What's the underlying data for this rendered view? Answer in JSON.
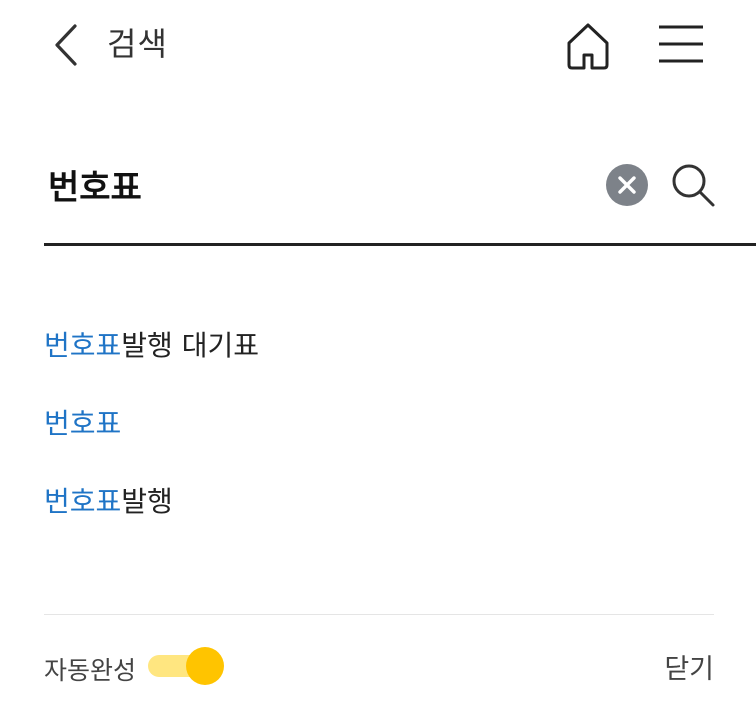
{
  "header": {
    "title": "검색"
  },
  "search": {
    "value": "번호표"
  },
  "suggestions": [
    {
      "highlight": "번호표",
      "rest": "발행 대기표"
    },
    {
      "highlight": "번호표",
      "rest": ""
    },
    {
      "highlight": "번호표",
      "rest": "발행"
    }
  ],
  "footer": {
    "autocomplete_label": "자동완성",
    "autocomplete_on": true,
    "close_label": "닫기"
  },
  "colors": {
    "highlight": "#1f74c6",
    "toggle_knob": "#ffc400",
    "toggle_track": "#ffe680",
    "clear_button": "#7d8289"
  },
  "icons": [
    "back-arrow-icon",
    "home-icon",
    "hamburger-menu-icon",
    "clear-x-icon",
    "search-icon"
  ]
}
